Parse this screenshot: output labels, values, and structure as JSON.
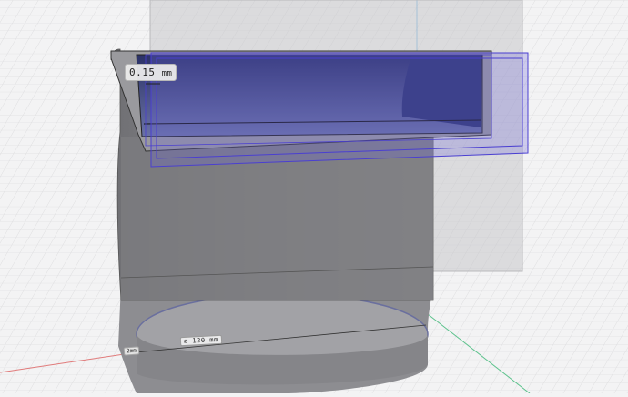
{
  "viewport": {
    "background": "#f3f3f4",
    "grid_color": "#dcdcde",
    "model_color": "#8f8f93",
    "selection_color": "#4a3fd1"
  },
  "dimensions": {
    "offset_value": "0.15",
    "offset_unit": "mm",
    "diameter_value": "⌀ 120",
    "diameter_unit": "mm",
    "small_value": "2",
    "small_unit": "mm"
  }
}
